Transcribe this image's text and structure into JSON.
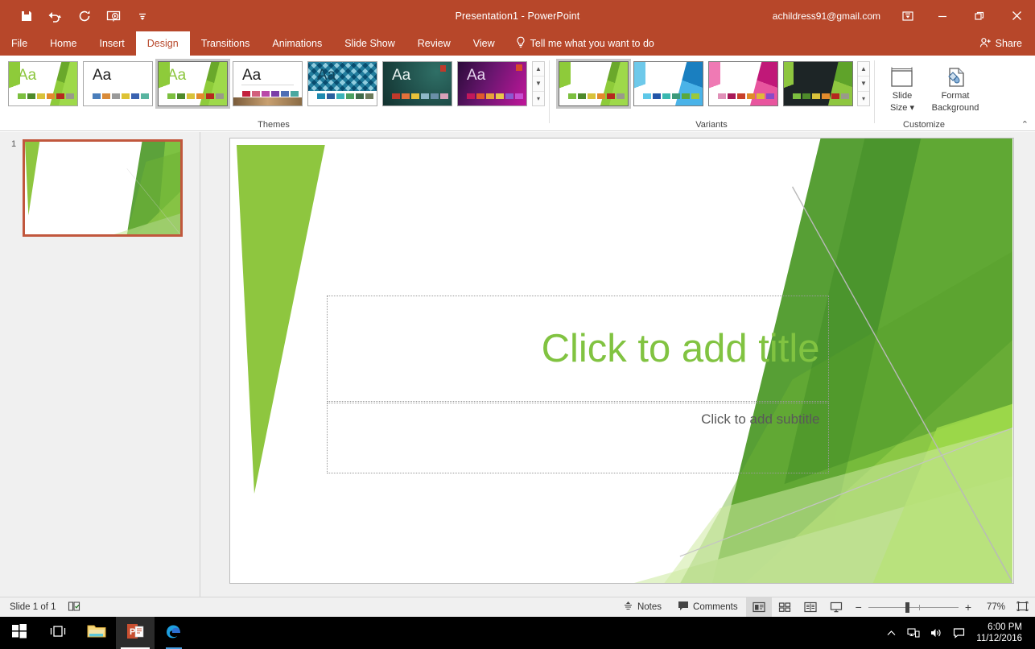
{
  "titlebar": {
    "document_title": "Presentation1  -  PowerPoint",
    "account": "achildress91@gmail.com",
    "qat": [
      {
        "name": "save-icon",
        "label": "Save"
      },
      {
        "name": "undo-icon",
        "label": "Undo"
      },
      {
        "name": "redo-icon",
        "label": "Redo"
      },
      {
        "name": "start-presentation-icon",
        "label": "Start From Beginning"
      },
      {
        "name": "customize-qat-icon",
        "label": "Customize Quick Access Toolbar"
      }
    ],
    "window_buttons": [
      {
        "name": "ribbon-display-options-icon",
        "label": "Ribbon Display Options"
      },
      {
        "name": "minimize-icon",
        "label": "Minimize"
      },
      {
        "name": "restore-icon",
        "label": "Restore Down"
      },
      {
        "name": "close-icon",
        "label": "Close"
      }
    ]
  },
  "tabs": [
    {
      "label": "File",
      "active": false
    },
    {
      "label": "Home",
      "active": false
    },
    {
      "label": "Insert",
      "active": false
    },
    {
      "label": "Design",
      "active": true
    },
    {
      "label": "Transitions",
      "active": false
    },
    {
      "label": "Animations",
      "active": false
    },
    {
      "label": "Slide Show",
      "active": false
    },
    {
      "label": "Review",
      "active": false
    },
    {
      "label": "View",
      "active": false
    }
  ],
  "tellme": {
    "label": "Tell me what you want to do",
    "icon": "lightbulb-icon"
  },
  "share": {
    "label": "Share",
    "icon": "share-person-icon"
  },
  "ribbon": {
    "groups": [
      {
        "label": "Themes"
      },
      {
        "label": "Variants"
      },
      {
        "label": "Customize"
      }
    ],
    "themes": [
      {
        "name": "facet-green",
        "aa": "Aa",
        "aa_color": "#8cc63e",
        "art": "facet",
        "swatches": [
          "#7cbf3f",
          "#4e8a2a",
          "#d9c23a",
          "#e28b2c",
          "#b5281f",
          "#9a9a8a"
        ],
        "selected": false
      },
      {
        "name": "office-blank",
        "aa": "Aa",
        "aa_color": "#1f1f1f",
        "art": "plain",
        "swatches": [
          "#4a7ebb",
          "#d98b3a",
          "#9a9a9a",
          "#ddc234",
          "#3a62b0",
          "#58b5a0"
        ],
        "selected": false
      },
      {
        "name": "facet-green-2",
        "aa": "Aa",
        "aa_color": "#8cc63e",
        "art": "facet",
        "swatches": [
          "#7cbf3f",
          "#4e8a2a",
          "#d9c23a",
          "#e28b2c",
          "#b5281f",
          "#9a9a8a"
        ],
        "selected": true
      },
      {
        "name": "wisp-wood",
        "aa": "Aa",
        "aa_color": "#1f1f1f",
        "art": "wisp",
        "swatches": [
          "#c2203c",
          "#d2607c",
          "#b94aa8",
          "#7a3fa8",
          "#4f6fb5",
          "#4aa8a0"
        ],
        "selected": false
      },
      {
        "name": "badge-teal",
        "aa": "Aa",
        "aa_color": "#123f52",
        "art": "badge",
        "swatches": [
          "#1e8ab0",
          "#2a5f9e",
          "#3ab3b8",
          "#4aa060",
          "#3f6b4a",
          "#6b7a5a"
        ],
        "selected": false
      },
      {
        "name": "ion-dark-teal",
        "aa": "Aa",
        "aa_color": "#e8f2f0",
        "art": "ion",
        "swatches": [
          "#c0392b",
          "#e2703a",
          "#e8c23a",
          "#8fb8c8",
          "#6a8fa8",
          "#d8a0b8"
        ],
        "selected": false
      },
      {
        "name": "berlin-purple",
        "aa": "Aa",
        "aa_color": "#e7d6ef",
        "art": "berlin",
        "swatches": [
          "#c2185b",
          "#e05a2b",
          "#e8a33a",
          "#e8c84a",
          "#8a5ad0",
          "#c74fd0"
        ],
        "selected": false
      }
    ],
    "variants": [
      {
        "name": "variant-green",
        "colors": [
          "#8ec63f",
          "#5fa32a"
        ],
        "dark": false,
        "swatches": [
          "#7cbf3f",
          "#4e8a2a",
          "#d9c23a",
          "#e28b2c",
          "#b5281f",
          "#9a9a8a"
        ],
        "selected": true
      },
      {
        "name": "variant-blue",
        "colors": [
          "#4ab3e8",
          "#1a7fc0"
        ],
        "dark": false,
        "swatches": [
          "#5ec8e8",
          "#2255a8",
          "#3ab8b0",
          "#3a9a7a",
          "#5aa83a",
          "#9ac83a"
        ],
        "selected": false
      },
      {
        "name": "variant-magenta",
        "colors": [
          "#e8559e",
          "#c01878"
        ],
        "dark": false,
        "swatches": [
          "#e090b8",
          "#a81858",
          "#c8402a",
          "#e08a2a",
          "#e0b83a",
          "#8a4ac8"
        ],
        "selected": false
      },
      {
        "name": "variant-dark",
        "colors": [
          "#8ec63f",
          "#5fa32a"
        ],
        "dark": true,
        "swatches": [
          "#7cbf3f",
          "#4e8a2a",
          "#d9c23a",
          "#e28b2c",
          "#b5281f",
          "#9a9a8a"
        ],
        "selected": false
      }
    ],
    "gallery_scroll": [
      {
        "name": "themes-scroll-up",
        "glyph": "▲"
      },
      {
        "name": "themes-scroll-down",
        "glyph": "▼"
      },
      {
        "name": "themes-more",
        "glyph": "▾"
      }
    ],
    "variants_scroll": [
      {
        "name": "variants-scroll-up",
        "glyph": "▲"
      },
      {
        "name": "variants-scroll-down",
        "glyph": "▼"
      },
      {
        "name": "variants-more",
        "glyph": "▾"
      }
    ],
    "customize": [
      {
        "name": "slide-size-button",
        "line1": "Slide",
        "line2": "Size ▾",
        "icon": "slide-size-icon"
      },
      {
        "name": "format-background-button",
        "line1": "Format",
        "line2": "Background",
        "icon": "format-background-icon"
      }
    ],
    "collapse_label": "⌃"
  },
  "slide_panel": {
    "slide_number": "1"
  },
  "slide": {
    "title_placeholder": "Click to add title",
    "subtitle_placeholder": "Click to add subtitle",
    "title_color": "#81c341",
    "subtitle_color": "#595959"
  },
  "statusbar": {
    "slide_count": "Slide 1 of 1",
    "accessibility_icon": "notes-check-icon",
    "notes": {
      "label": "Notes",
      "icon": "notes-icon"
    },
    "comments": {
      "label": "Comments",
      "icon": "comment-icon"
    },
    "views": [
      {
        "name": "view-normal",
        "label": "Normal",
        "glyph": "normal",
        "active": true
      },
      {
        "name": "view-slide-sorter",
        "label": "Slide Sorter",
        "glyph": "sorter",
        "active": false
      },
      {
        "name": "view-reading",
        "label": "Reading View",
        "glyph": "reading",
        "active": false
      },
      {
        "name": "view-slide-show",
        "label": "Slide Show",
        "glyph": "show",
        "active": false
      }
    ],
    "zoom": {
      "out_label": "−",
      "in_label": "+",
      "percent": "77%",
      "fit_label": "Fit slide to current window"
    }
  },
  "taskbar": {
    "items": [
      {
        "name": "start-button",
        "icon": "windows-logo-icon",
        "state": "idle"
      },
      {
        "name": "task-view-button",
        "icon": "task-view-icon",
        "state": "idle"
      },
      {
        "name": "file-explorer-button",
        "icon": "folder-icon",
        "state": "idle"
      },
      {
        "name": "powerpoint-button",
        "icon": "powerpoint-icon",
        "state": "active"
      },
      {
        "name": "edge-button",
        "icon": "edge-icon",
        "state": "open"
      }
    ],
    "tray": [
      {
        "name": "show-hidden-icons",
        "icon": "chevron-up-icon"
      },
      {
        "name": "network-icon",
        "icon": "network-icon"
      },
      {
        "name": "volume-icon",
        "icon": "speaker-icon"
      },
      {
        "name": "action-center-icon",
        "icon": "notification-icon"
      }
    ],
    "clock": {
      "time": "6:00 PM",
      "date": "11/12/2016"
    }
  }
}
